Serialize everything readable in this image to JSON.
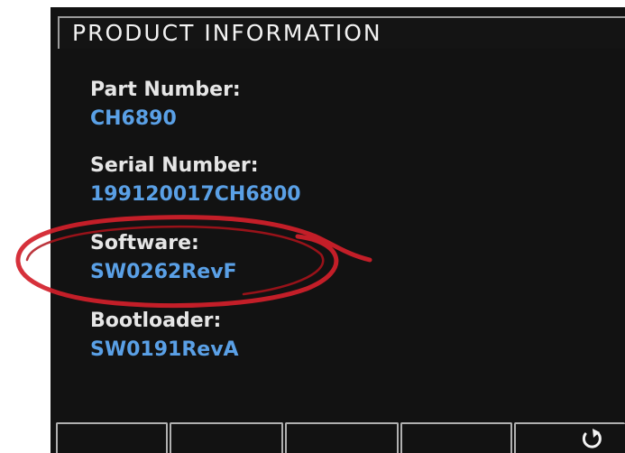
{
  "screen": {
    "title": "PRODUCT INFORMATION",
    "fields": [
      {
        "label": "Part Number:",
        "value": "CH6890"
      },
      {
        "label": "Serial Number:",
        "value": "199120017CH6800"
      },
      {
        "label": "Software:",
        "value": "SW0262RevF"
      },
      {
        "label": "Bootloader:",
        "value": "SW0191RevA"
      }
    ],
    "softkeys": [
      {
        "label": ""
      },
      {
        "label": ""
      },
      {
        "label": ""
      },
      {
        "label": ""
      },
      {
        "label": "",
        "icon": "back-arrow-icon"
      }
    ]
  },
  "colors": {
    "background": "#121212",
    "label": "#e6e6e6",
    "value": "#5aa0e6",
    "annotation": "#d2202a"
  }
}
